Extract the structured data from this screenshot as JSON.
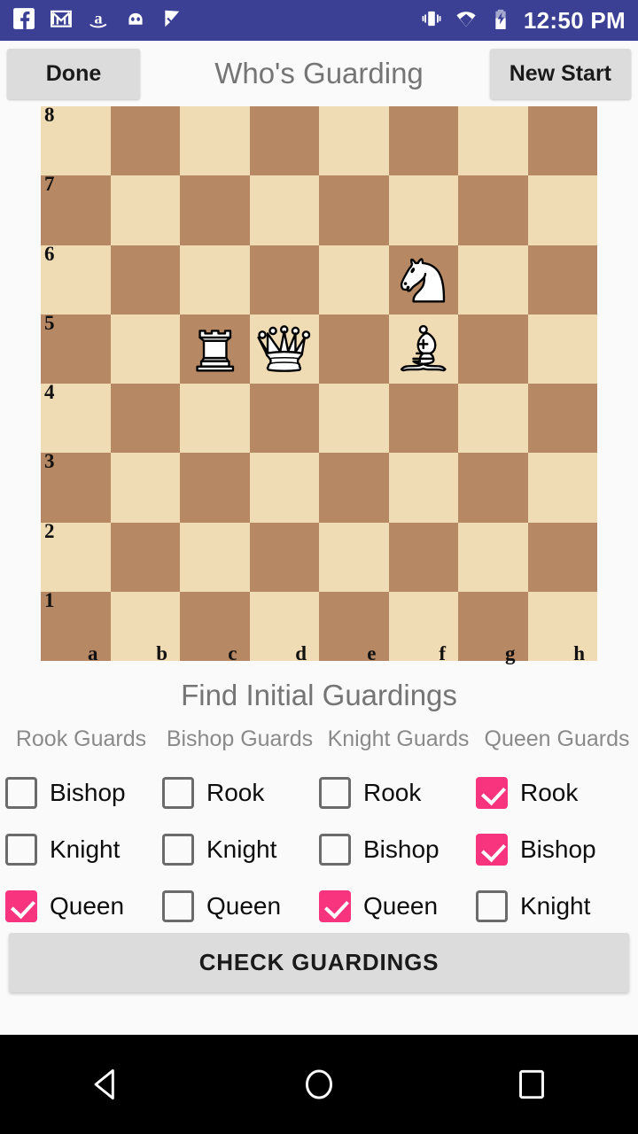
{
  "status_bar": {
    "background": "#3B4095",
    "time": "12:50 PM",
    "left_icons": [
      "facebook-icon",
      "gmail-icon",
      "amazon-icon",
      "cyanogenmod-icon",
      "checkmark-app-icon"
    ],
    "right_icons": [
      "vibrate-icon",
      "wifi-icon",
      "battery-charging-icon"
    ]
  },
  "app_bar": {
    "done_label": "Done",
    "title": "Who's Guarding",
    "new_start_label": "New Start"
  },
  "board": {
    "light_color": "#F0DCB4",
    "dark_color": "#B68863",
    "ranks": [
      "8",
      "7",
      "6",
      "5",
      "4",
      "3",
      "2",
      "1"
    ],
    "files": [
      "a",
      "b",
      "c",
      "d",
      "e",
      "f",
      "g",
      "h"
    ],
    "pieces": [
      {
        "square": "f6",
        "piece": "white-knight",
        "color": "white",
        "type": "knight"
      },
      {
        "square": "c5",
        "piece": "white-rook",
        "color": "white",
        "type": "rook"
      },
      {
        "square": "d5",
        "piece": "white-queen",
        "color": "white",
        "type": "queen"
      },
      {
        "square": "f5",
        "piece": "white-bishop",
        "color": "white",
        "type": "bishop"
      }
    ]
  },
  "puzzle": {
    "title": "Find Initial Guardings",
    "accent_color": "#F9347F",
    "columns": [
      {
        "header": "Rook Guards",
        "options": [
          {
            "label": "Bishop",
            "checked": false
          },
          {
            "label": "Knight",
            "checked": false
          },
          {
            "label": "Queen",
            "checked": true
          }
        ]
      },
      {
        "header": "Bishop Guards",
        "options": [
          {
            "label": "Rook",
            "checked": false
          },
          {
            "label": "Knight",
            "checked": false
          },
          {
            "label": "Queen",
            "checked": false
          }
        ]
      },
      {
        "header": "Knight Guards",
        "options": [
          {
            "label": "Rook",
            "checked": false
          },
          {
            "label": "Bishop",
            "checked": false
          },
          {
            "label": "Queen",
            "checked": true
          }
        ]
      },
      {
        "header": "Queen Guards",
        "options": [
          {
            "label": "Rook",
            "checked": true
          },
          {
            "label": "Bishop",
            "checked": true
          },
          {
            "label": "Knight",
            "checked": false
          }
        ]
      }
    ],
    "check_button_label": "CHECK GUARDINGS"
  },
  "nav_bar": {
    "items": [
      "back-nav-icon",
      "home-nav-icon",
      "recents-nav-icon"
    ]
  }
}
